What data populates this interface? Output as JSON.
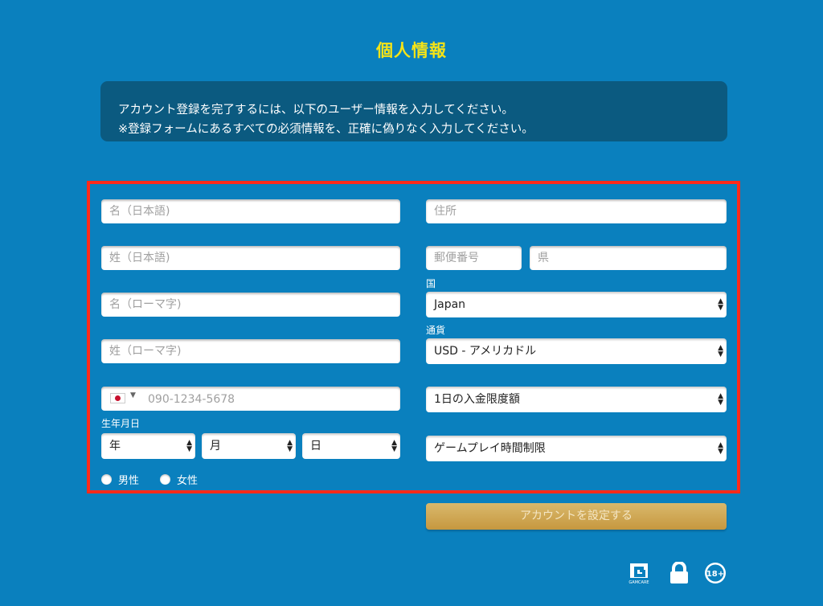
{
  "page": {
    "title": "個人情報",
    "notice_line1": "アカウント登録を完了するには、以下のユーザー情報を入力してください。",
    "notice_line2": "※登録フォームにあるすべての必須情報を、正確に偽りなく入力してください。"
  },
  "form": {
    "first_name_jp": {
      "placeholder": "名（日本語)"
    },
    "last_name_jp": {
      "placeholder": "姓（日本語)"
    },
    "first_name_romaji": {
      "placeholder": "名（ローマ字)"
    },
    "last_name_romaji": {
      "placeholder": "姓（ローマ字)"
    },
    "phone": {
      "placeholder": "090-1234-5678",
      "country_flag": "japan-flag-icon"
    },
    "birthdate": {
      "label": "生年月日",
      "year": "年",
      "month": "月",
      "day": "日"
    },
    "gender": {
      "male": "男性",
      "female": "女性"
    },
    "address": {
      "placeholder": "住所"
    },
    "postal_code": {
      "placeholder": "郵便番号"
    },
    "prefecture": {
      "placeholder": "県"
    },
    "country": {
      "label": "国",
      "value": "Japan"
    },
    "currency": {
      "label": "通貨",
      "value": "USD - アメリカドル"
    },
    "deposit_limit": {
      "value": "1日の入金限度額"
    },
    "play_time_limit": {
      "value": "ゲームプレイ時間制限"
    },
    "submit_label": "アカウントを設定する"
  },
  "footer": {
    "icons": [
      "gamcare-icon",
      "lock-icon",
      "age-18-icon"
    ],
    "gamcare_text": "GAMCARE",
    "age_text": "18+"
  },
  "colors": {
    "background": "#0a80be",
    "title": "#f4e318",
    "notice_bg": "#0b5a80",
    "highlight_border": "#ff2a1a",
    "submit": "#cfa652"
  }
}
